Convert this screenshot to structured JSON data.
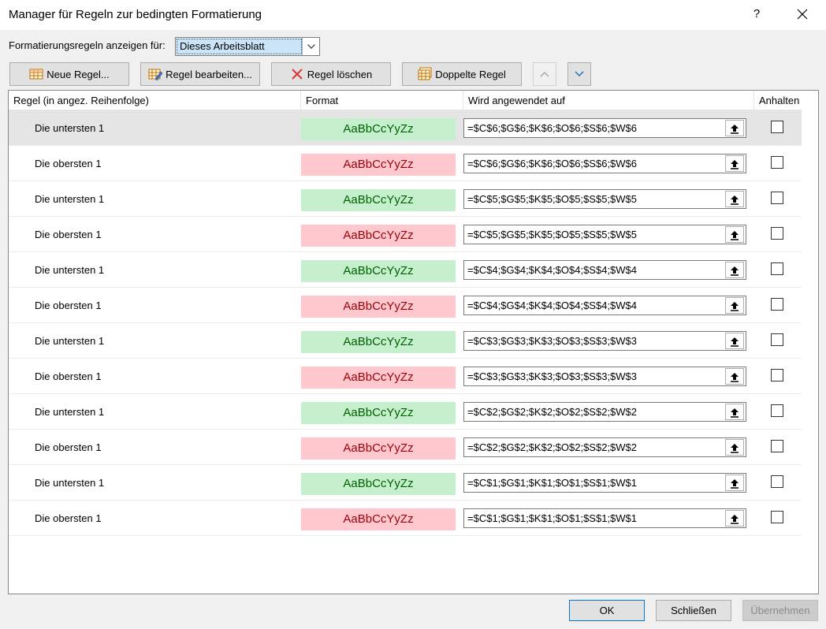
{
  "window": {
    "title": "Manager für Regeln zur bedingten Formatierung",
    "help": "?",
    "close_icon": "close-icon"
  },
  "show_rules": {
    "label": "Formatierungsregeln anzeigen für:",
    "selected": "Dieses Arbeitsblatt"
  },
  "toolbar": {
    "new_rule": "Neue Regel...",
    "edit_rule": "Regel bearbeiten...",
    "delete_rule": "Regel löschen",
    "duplicate_rule": "Doppelte Regel"
  },
  "columns": {
    "rule": "Regel (in angez. Reihenfolge)",
    "format": "Format",
    "applies_to": "Wird angewendet auf",
    "stop": "Anhalten"
  },
  "colors": {
    "green_bg": "#c6efce",
    "green_fg": "#006100",
    "red_bg": "#ffc7ce",
    "red_fg": "#9c0006"
  },
  "rules": [
    {
      "name": "Die untersten 1",
      "preview": "AaBbCcYyZz",
      "style": "green",
      "applies": "=$C$6;$G$6;$K$6;$O$6;$S$6;$W$6",
      "stop": false
    },
    {
      "name": "Die obersten 1",
      "preview": "AaBbCcYyZz",
      "style": "red",
      "applies": "=$C$6;$G$6;$K$6;$O$6;$S$6;$W$6",
      "stop": false
    },
    {
      "name": "Die untersten 1",
      "preview": "AaBbCcYyZz",
      "style": "green",
      "applies": "=$C$5;$G$5;$K$5;$O$5;$S$5;$W$5",
      "stop": false
    },
    {
      "name": "Die obersten 1",
      "preview": "AaBbCcYyZz",
      "style": "red",
      "applies": "=$C$5;$G$5;$K$5;$O$5;$S$5;$W$5",
      "stop": false
    },
    {
      "name": "Die untersten 1",
      "preview": "AaBbCcYyZz",
      "style": "green",
      "applies": "=$C$4;$G$4;$K$4;$O$4;$S$4;$W$4",
      "stop": false
    },
    {
      "name": "Die obersten 1",
      "preview": "AaBbCcYyZz",
      "style": "red",
      "applies": "=$C$4;$G$4;$K$4;$O$4;$S$4;$W$4",
      "stop": false
    },
    {
      "name": "Die untersten 1",
      "preview": "AaBbCcYyZz",
      "style": "green",
      "applies": "=$C$3;$G$3;$K$3;$O$3;$S$3;$W$3",
      "stop": false
    },
    {
      "name": "Die obersten 1",
      "preview": "AaBbCcYyZz",
      "style": "red",
      "applies": "=$C$3;$G$3;$K$3;$O$3;$S$3;$W$3",
      "stop": false
    },
    {
      "name": "Die untersten 1",
      "preview": "AaBbCcYyZz",
      "style": "green",
      "applies": "=$C$2;$G$2;$K$2;$O$2;$S$2;$W$2",
      "stop": false
    },
    {
      "name": "Die obersten 1",
      "preview": "AaBbCcYyZz",
      "style": "red",
      "applies": "=$C$2;$G$2;$K$2;$O$2;$S$2;$W$2",
      "stop": false
    },
    {
      "name": "Die untersten 1",
      "preview": "AaBbCcYyZz",
      "style": "green",
      "applies": "=$C$1;$G$1;$K$1;$O$1;$S$1;$W$1",
      "stop": false
    },
    {
      "name": "Die obersten 1",
      "preview": "AaBbCcYyZz",
      "style": "red",
      "applies": "=$C$1;$G$1;$K$1;$O$1;$S$1;$W$1",
      "stop": false
    }
  ],
  "footer": {
    "ok": "OK",
    "close": "Schließen",
    "apply": "Übernehmen"
  }
}
